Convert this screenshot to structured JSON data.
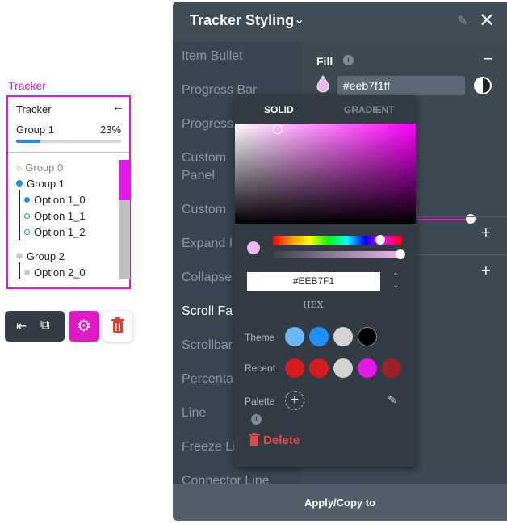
{
  "tracker": {
    "caption": "Tracker",
    "header": "Tracker",
    "back_icon": "←",
    "group_title": "Group 1",
    "percent": "23%",
    "progress_fraction": 0.23,
    "items": [
      {
        "label": "Group 0",
        "icon": "○"
      },
      {
        "label": "Group 1"
      },
      {
        "label": "Option 1_0"
      },
      {
        "label": "Option 1_1"
      },
      {
        "label": "Option 1_2"
      },
      {
        "label": "Group 2"
      },
      {
        "label": "Option 2_0"
      }
    ]
  },
  "toolbar": {
    "dock_icon": "⇤",
    "open_icon": "⧉",
    "gear_icon": "⚙"
  },
  "panel": {
    "title": "Tracker Styling",
    "nav_items": [
      "Item Bullet",
      "Progress Bar",
      "Progress",
      "Custom",
      "Panel",
      "Custom",
      "Expand I",
      "Collapse",
      "Scroll Fa",
      "Scrollbar",
      "Percenta",
      "Line",
      "Freeze Li",
      "Connector Line"
    ],
    "fill_label": "Fill",
    "fill_value": "#eeb7f1ff",
    "footer": "Apply/Copy to"
  },
  "picker": {
    "tab_solid": "SOLID",
    "tab_gradient": "GRADIENT",
    "hex_value": "#EEB7F1",
    "hex_label": "HEX",
    "theme_label": "Theme",
    "recent_label": "Recent",
    "palette_label": "Palette",
    "delete_label": "Delete",
    "theme_colors": [
      "#6ab8f5",
      "#1e90ff",
      "#d3d3d3",
      "#000000"
    ],
    "recent_colors": [
      "#d81b22",
      "#d81b22",
      "#d3d3d3",
      "#e219e8",
      "#9b2226"
    ]
  },
  "colors": {
    "accent": "#e219c4",
    "panel_bg": "#3a4650",
    "fill": "#eeb7f1"
  }
}
